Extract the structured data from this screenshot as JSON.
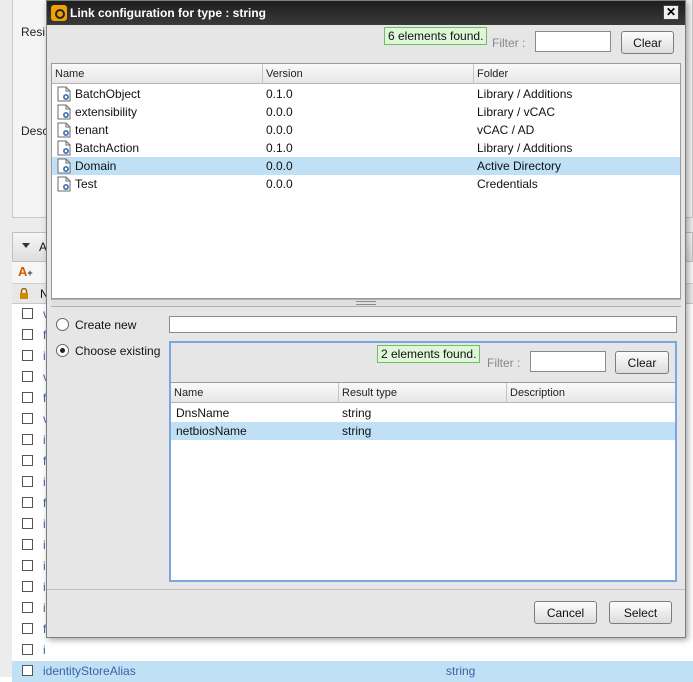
{
  "background": {
    "side_labels": [
      "Resi",
      "Desc"
    ],
    "section_label": "A",
    "add_icon_glyph": "A",
    "header_first_letter": "N",
    "row_letters": [
      "v",
      "f",
      "i",
      "v",
      "f",
      "v",
      "i",
      "f",
      "i",
      "f",
      "i",
      "i",
      "i",
      "i",
      "i",
      "f",
      "i"
    ],
    "selected_row": {
      "name": "identityStoreAlias",
      "type": "string"
    }
  },
  "dialog": {
    "title": "Link configuration for type : string",
    "close_glyph": "✕",
    "top": {
      "found": "6 elements found.",
      "filter_label": "Filter :",
      "filter_value": "",
      "clear_label": "Clear",
      "columns": [
        "Name",
        "Version",
        "Folder"
      ],
      "rows": [
        {
          "name": "BatchObject",
          "version": "0.1.0",
          "folder": "Library / Additions",
          "selected": false
        },
        {
          "name": "extensibility",
          "version": "0.0.0",
          "folder": "Library / vCAC",
          "selected": false
        },
        {
          "name": "tenant",
          "version": "0.0.0",
          "folder": "vCAC / AD",
          "selected": false
        },
        {
          "name": "BatchAction",
          "version": "0.1.0",
          "folder": "Library / Additions",
          "selected": false
        },
        {
          "name": "Domain",
          "version": "0.0.0",
          "folder": "Active Directory",
          "selected": true
        },
        {
          "name": "Test",
          "version": "0.0.0",
          "folder": "Credentials",
          "selected": false
        }
      ]
    },
    "create_new_label": "Create new",
    "create_new_value": "",
    "choose_existing_label": "Choose existing",
    "existing": {
      "found": "2 elements found.",
      "filter_label": "Filter :",
      "filter_value": "",
      "clear_label": "Clear",
      "columns": [
        "Name",
        "Result type",
        "Description"
      ],
      "rows": [
        {
          "name": "DnsName",
          "type": "string",
          "description": "",
          "selected": false
        },
        {
          "name": "netbiosName",
          "type": "string",
          "description": "",
          "selected": true
        }
      ]
    },
    "cancel_label": "Cancel",
    "select_label": "Select"
  },
  "icons": {
    "element": "action-element-icon",
    "lock": "lock-icon",
    "add": "add-attribute-icon"
  }
}
